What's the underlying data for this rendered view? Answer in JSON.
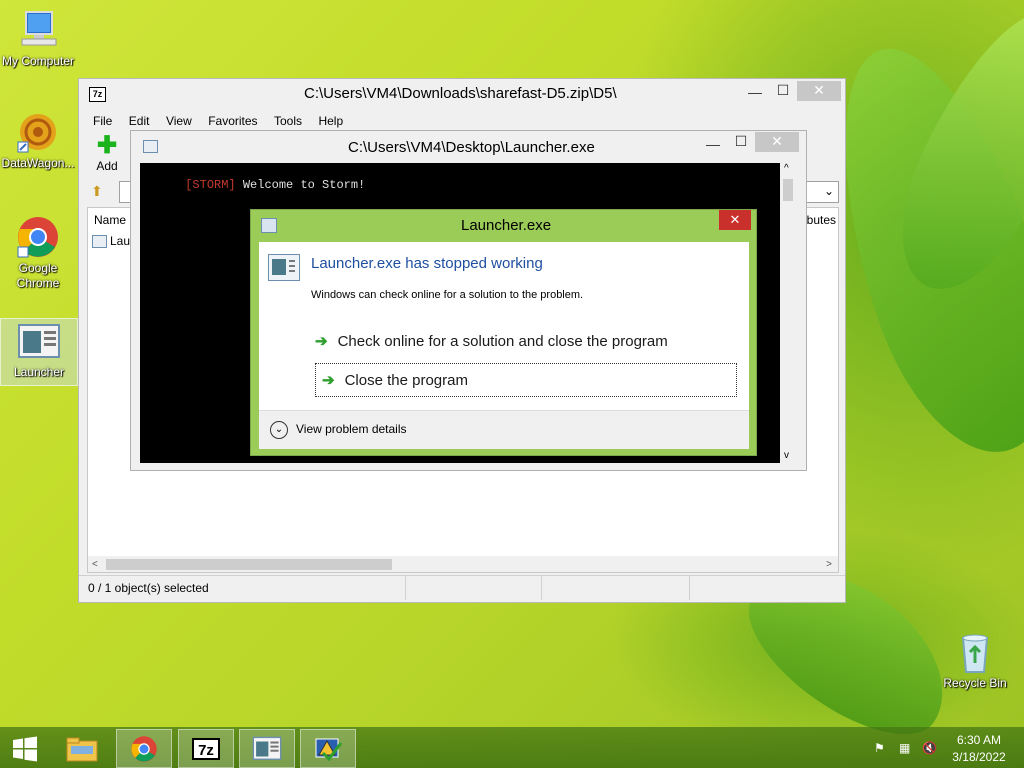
{
  "desktop": {
    "icons": [
      {
        "label": "My Computer"
      },
      {
        "label": "DataWagon..."
      },
      {
        "label": "Google Chrome"
      },
      {
        "label": "Launcher"
      },
      {
        "label": "Recycle Bin"
      }
    ]
  },
  "explorer": {
    "app_icon_text": "7z",
    "title": "C:\\Users\\VM4\\Downloads\\sharefast-D5.zip\\D5\\",
    "menu": [
      "File",
      "Edit",
      "View",
      "Favorites",
      "Tools",
      "Help"
    ],
    "toolbar": {
      "add_label": "Add"
    },
    "columns": {
      "name": "Name",
      "attributes": "ributes"
    },
    "files": [
      {
        "name": "Lau"
      }
    ],
    "status": "0 / 1 object(s) selected"
  },
  "console": {
    "title": "C:\\Users\\VM4\\Desktop\\Launcher.exe",
    "line_tag": "[STORM]",
    "line_text": " Welcome to Storm!"
  },
  "dialog": {
    "title": "Launcher.exe",
    "heading": "Launcher.exe has stopped working",
    "description": "Windows can check online for a solution to the problem.",
    "option1": "Check online for a solution and close the program",
    "option2": "Close the program",
    "details": "View problem details"
  },
  "taskbar": {
    "app_7z_text": "7z",
    "time": "6:30 AM",
    "date": "3/18/2022"
  },
  "colors": {
    "dialog_frame": "#9ccc58",
    "link_blue": "#1f4fa0",
    "arrow_green": "#2e9e2e"
  }
}
